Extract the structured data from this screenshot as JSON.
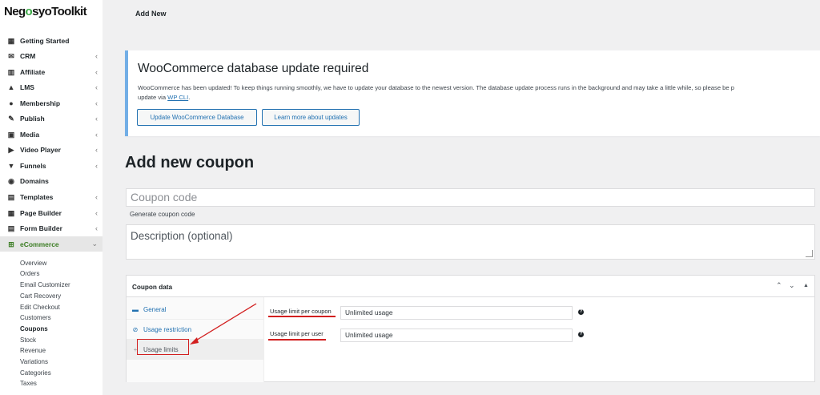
{
  "brand": {
    "logo_part1": "Neg",
    "logo_accent": "o",
    "logo_part2": "syoToolkit",
    "accent_color": "#3aa845"
  },
  "topbar": {
    "title": "Add New"
  },
  "sidebar": {
    "items": [
      {
        "label": "Getting Started",
        "icon": "grid-icon"
      },
      {
        "label": "CRM",
        "icon": "mail-icon"
      },
      {
        "label": "Affiliate",
        "icon": "chart-icon"
      },
      {
        "label": "LMS",
        "icon": "graduation-cap-icon"
      },
      {
        "label": "Membership",
        "icon": "users-icon"
      },
      {
        "label": "Publish",
        "icon": "pin-icon"
      },
      {
        "label": "Media",
        "icon": "media-icon"
      },
      {
        "label": "Video Player",
        "icon": "play-icon"
      },
      {
        "label": "Funnels",
        "icon": "funnel-icon"
      },
      {
        "label": "Domains",
        "icon": "globe-icon"
      },
      {
        "label": "Templates",
        "icon": "template-icon"
      },
      {
        "label": "Page Builder",
        "icon": "layout-icon"
      },
      {
        "label": "Form Builder",
        "icon": "form-icon"
      },
      {
        "label": "eCommerce",
        "icon": "basket-icon"
      }
    ],
    "submenu": [
      "Overview",
      "Orders",
      "Email Customizer",
      "Cart Recovery",
      "Edit Checkout",
      "Customers",
      "Coupons",
      "Stock",
      "Revenue",
      "Variations",
      "Categories",
      "Taxes"
    ]
  },
  "notice": {
    "title": "WooCommerce database update required",
    "body": "WooCommerce has been updated! To keep things running smoothly, we have to update your database to the newest version. The database update process runs in the background and may take a little while, so please be p",
    "body_line2": "update via",
    "link": "WP CLI",
    "link_suffix": ".",
    "btn_update": "Update WooCommerce Database",
    "btn_learn": "Learn more about updates",
    "accent_color": "#72aee6"
  },
  "page": {
    "heading": "Add new coupon",
    "coupon_placeholder": "Coupon code",
    "generate_link": "Generate coupon code",
    "description_placeholder": "Description (optional)"
  },
  "coupon_data": {
    "title": "Coupon data",
    "tabs": [
      {
        "label": "General",
        "icon": "ticket-icon"
      },
      {
        "label": "Usage restriction",
        "icon": "ban-icon"
      },
      {
        "label": "Usage limits",
        "icon": "plus-icon"
      }
    ],
    "fields": [
      {
        "label": "Usage limit per coupon",
        "value": "Unlimited usage"
      },
      {
        "label": "Usage limit per user",
        "value": "Unlimited usage"
      }
    ],
    "highlight_color": "#d21f1f"
  }
}
